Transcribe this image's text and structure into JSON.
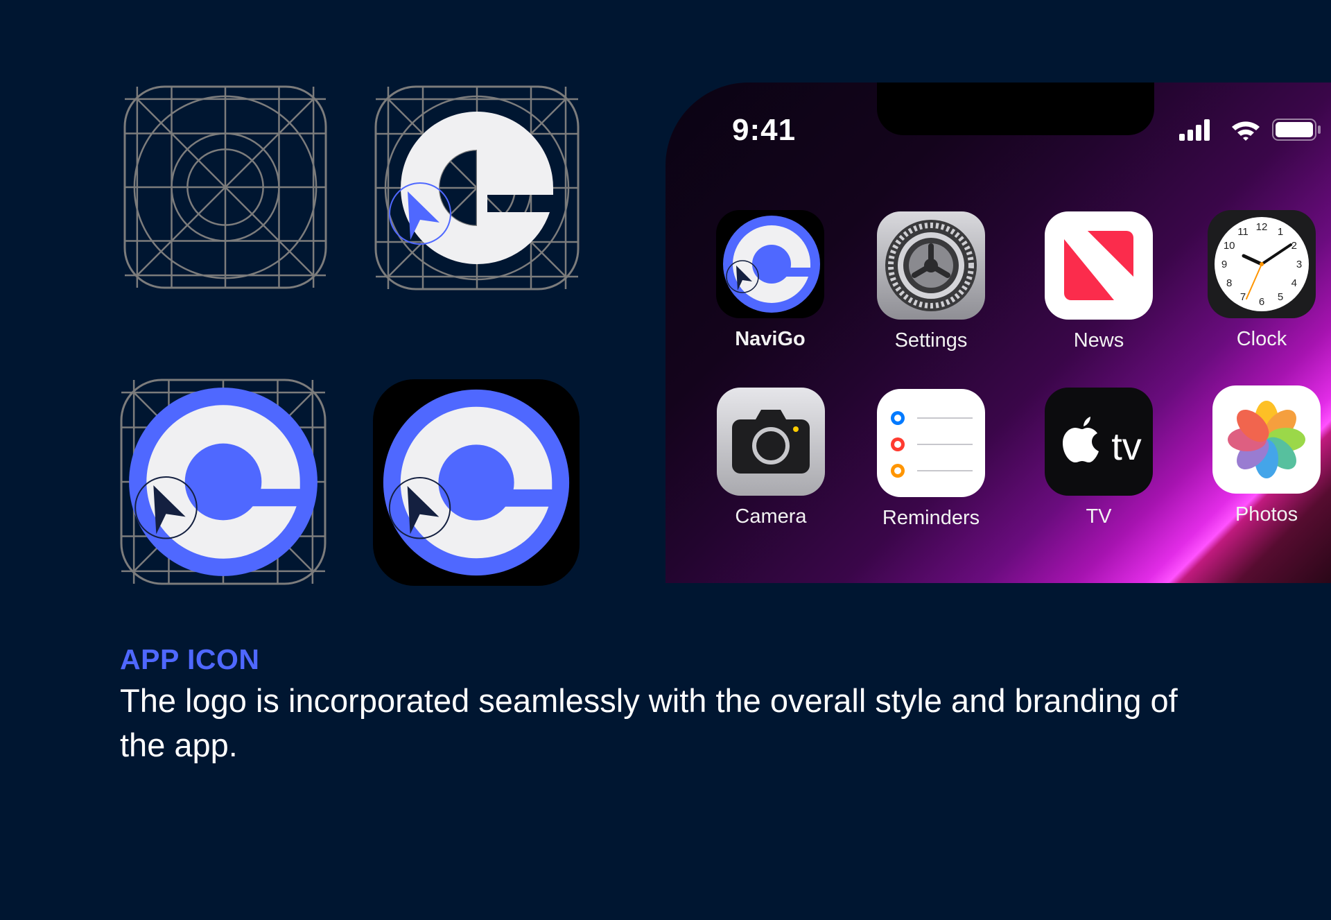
{
  "brand": {
    "primary_color": "#4f68ff",
    "light_color": "#f0f0f2",
    "background_color": "#001631",
    "grid_color": "#808080"
  },
  "icon_variants": [
    {
      "name": "grid-template",
      "icon": "ios-icon-grid"
    },
    {
      "name": "construction",
      "icon": "navigo-logo-construction"
    },
    {
      "name": "filled-on-grid",
      "icon": "navigo-logo-on-grid"
    },
    {
      "name": "final",
      "icon": "navigo-app-icon"
    }
  ],
  "phone": {
    "status_time": "9:41",
    "status_icons": [
      "signal-icon",
      "wifi-icon",
      "battery-icon"
    ],
    "apps": [
      {
        "label": "NaviGo",
        "icon": "navigo-icon"
      },
      {
        "label": "Settings",
        "icon": "gear-icon"
      },
      {
        "label": "News",
        "icon": "news-icon"
      },
      {
        "label": "Clock",
        "icon": "clock-icon"
      },
      {
        "label": "Camera",
        "icon": "camera-icon"
      },
      {
        "label": "Reminders",
        "icon": "reminders-icon"
      },
      {
        "label": "TV",
        "icon": "apple-tv-icon"
      },
      {
        "label": "Photos",
        "icon": "photos-icon"
      }
    ],
    "clock_numbers": [
      "12",
      "1",
      "2",
      "3",
      "4",
      "5",
      "6",
      "7",
      "8",
      "9",
      "10",
      "11"
    ],
    "tv_wordmark": "tv"
  },
  "caption": {
    "title": "APP ICON",
    "body": "The logo is incorporated seamlessly with the overall style and branding of the app."
  }
}
